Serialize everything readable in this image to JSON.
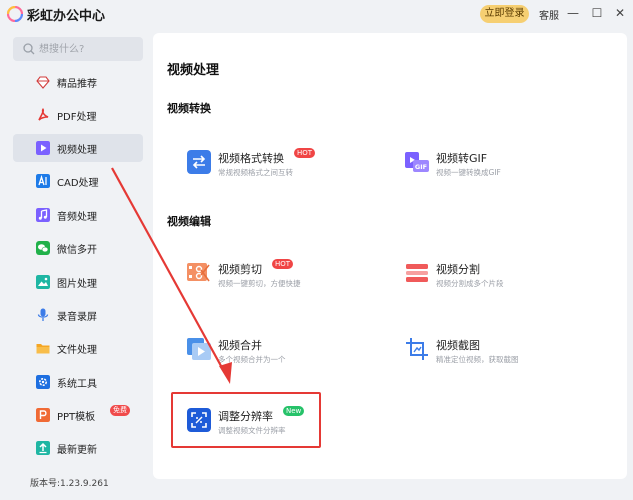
{
  "app": {
    "title": "彩虹办公中心",
    "login_label": "立即登录",
    "support_label": "客服",
    "minimize_glyph": "—",
    "maximize_glyph": "☐",
    "close_glyph": "✕"
  },
  "search": {
    "placeholder": "想搜什么?"
  },
  "sidebar": {
    "items": [
      {
        "label": "精品推荐",
        "icon": "recommend-icon",
        "color": "#ffffff"
      },
      {
        "label": "PDF处理",
        "icon": "pdf-icon",
        "color": "#e53935"
      },
      {
        "label": "视频处理",
        "icon": "video-icon",
        "color": "#7b61ff"
      },
      {
        "label": "CAD处理",
        "icon": "cad-icon",
        "color": "#1e7be8"
      },
      {
        "label": "音频处理",
        "icon": "audio-icon",
        "color": "#7b61ff"
      },
      {
        "label": "微信多开",
        "icon": "wechat-icon",
        "color": "#21b14a"
      },
      {
        "label": "图片处理",
        "icon": "image-icon",
        "color": "#1fb6a3"
      },
      {
        "label": "录音录屏",
        "icon": "record-icon",
        "color": "#3c7ce8"
      },
      {
        "label": "文件处理",
        "icon": "folder-icon",
        "color": "#f5a623"
      },
      {
        "label": "系统工具",
        "icon": "gear-icon",
        "color": "#1e6fe0"
      },
      {
        "label": "PPT模板",
        "icon": "ppt-icon",
        "color": "#f06a35",
        "badge": "免费"
      },
      {
        "label": "最新更新",
        "icon": "update-icon",
        "color": "#1fb6a3"
      }
    ],
    "version": "版本号:1.23.9.261"
  },
  "main": {
    "title": "视频处理",
    "sections": [
      {
        "title": "视频转换",
        "tools": [
          {
            "name": "视频格式转换",
            "desc": "常规视频格式之间互转",
            "badge": "HOT"
          },
          {
            "name": "视频转GIF",
            "desc": "视频一键转换成GIF"
          }
        ]
      },
      {
        "title": "视频编辑",
        "tools": [
          {
            "name": "视频剪切",
            "desc": "视频一键剪切，方便快捷",
            "badge": "HOT"
          },
          {
            "name": "视频分割",
            "desc": "视频分割成多个片段"
          },
          {
            "name": "视频合并",
            "desc": "多个视频合并为一个"
          },
          {
            "name": "视频截图",
            "desc": "精准定位视频，获取截图"
          },
          {
            "name": "调整分辨率",
            "desc": "调整视频文件分辨率",
            "badge": "New"
          }
        ]
      }
    ]
  },
  "colors": {
    "accent": "#7b61ff",
    "highlight": "#e53935",
    "hot": "#f04545",
    "new": "#26c269"
  }
}
